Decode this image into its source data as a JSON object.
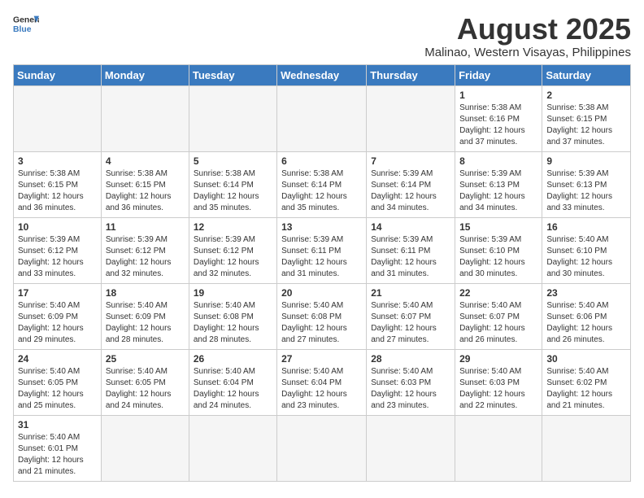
{
  "header": {
    "logo_general": "General",
    "logo_blue": "Blue",
    "month_year": "August 2025",
    "location": "Malinao, Western Visayas, Philippines"
  },
  "days_of_week": [
    "Sunday",
    "Monday",
    "Tuesday",
    "Wednesday",
    "Thursday",
    "Friday",
    "Saturday"
  ],
  "weeks": [
    [
      {
        "day": "",
        "info": ""
      },
      {
        "day": "",
        "info": ""
      },
      {
        "day": "",
        "info": ""
      },
      {
        "day": "",
        "info": ""
      },
      {
        "day": "",
        "info": ""
      },
      {
        "day": "1",
        "info": "Sunrise: 5:38 AM\nSunset: 6:16 PM\nDaylight: 12 hours\nand 37 minutes."
      },
      {
        "day": "2",
        "info": "Sunrise: 5:38 AM\nSunset: 6:15 PM\nDaylight: 12 hours\nand 37 minutes."
      }
    ],
    [
      {
        "day": "3",
        "info": "Sunrise: 5:38 AM\nSunset: 6:15 PM\nDaylight: 12 hours\nand 36 minutes."
      },
      {
        "day": "4",
        "info": "Sunrise: 5:38 AM\nSunset: 6:15 PM\nDaylight: 12 hours\nand 36 minutes."
      },
      {
        "day": "5",
        "info": "Sunrise: 5:38 AM\nSunset: 6:14 PM\nDaylight: 12 hours\nand 35 minutes."
      },
      {
        "day": "6",
        "info": "Sunrise: 5:38 AM\nSunset: 6:14 PM\nDaylight: 12 hours\nand 35 minutes."
      },
      {
        "day": "7",
        "info": "Sunrise: 5:39 AM\nSunset: 6:14 PM\nDaylight: 12 hours\nand 34 minutes."
      },
      {
        "day": "8",
        "info": "Sunrise: 5:39 AM\nSunset: 6:13 PM\nDaylight: 12 hours\nand 34 minutes."
      },
      {
        "day": "9",
        "info": "Sunrise: 5:39 AM\nSunset: 6:13 PM\nDaylight: 12 hours\nand 33 minutes."
      }
    ],
    [
      {
        "day": "10",
        "info": "Sunrise: 5:39 AM\nSunset: 6:12 PM\nDaylight: 12 hours\nand 33 minutes."
      },
      {
        "day": "11",
        "info": "Sunrise: 5:39 AM\nSunset: 6:12 PM\nDaylight: 12 hours\nand 32 minutes."
      },
      {
        "day": "12",
        "info": "Sunrise: 5:39 AM\nSunset: 6:12 PM\nDaylight: 12 hours\nand 32 minutes."
      },
      {
        "day": "13",
        "info": "Sunrise: 5:39 AM\nSunset: 6:11 PM\nDaylight: 12 hours\nand 31 minutes."
      },
      {
        "day": "14",
        "info": "Sunrise: 5:39 AM\nSunset: 6:11 PM\nDaylight: 12 hours\nand 31 minutes."
      },
      {
        "day": "15",
        "info": "Sunrise: 5:39 AM\nSunset: 6:10 PM\nDaylight: 12 hours\nand 30 minutes."
      },
      {
        "day": "16",
        "info": "Sunrise: 5:40 AM\nSunset: 6:10 PM\nDaylight: 12 hours\nand 30 minutes."
      }
    ],
    [
      {
        "day": "17",
        "info": "Sunrise: 5:40 AM\nSunset: 6:09 PM\nDaylight: 12 hours\nand 29 minutes."
      },
      {
        "day": "18",
        "info": "Sunrise: 5:40 AM\nSunset: 6:09 PM\nDaylight: 12 hours\nand 28 minutes."
      },
      {
        "day": "19",
        "info": "Sunrise: 5:40 AM\nSunset: 6:08 PM\nDaylight: 12 hours\nand 28 minutes."
      },
      {
        "day": "20",
        "info": "Sunrise: 5:40 AM\nSunset: 6:08 PM\nDaylight: 12 hours\nand 27 minutes."
      },
      {
        "day": "21",
        "info": "Sunrise: 5:40 AM\nSunset: 6:07 PM\nDaylight: 12 hours\nand 27 minutes."
      },
      {
        "day": "22",
        "info": "Sunrise: 5:40 AM\nSunset: 6:07 PM\nDaylight: 12 hours\nand 26 minutes."
      },
      {
        "day": "23",
        "info": "Sunrise: 5:40 AM\nSunset: 6:06 PM\nDaylight: 12 hours\nand 26 minutes."
      }
    ],
    [
      {
        "day": "24",
        "info": "Sunrise: 5:40 AM\nSunset: 6:05 PM\nDaylight: 12 hours\nand 25 minutes."
      },
      {
        "day": "25",
        "info": "Sunrise: 5:40 AM\nSunset: 6:05 PM\nDaylight: 12 hours\nand 24 minutes."
      },
      {
        "day": "26",
        "info": "Sunrise: 5:40 AM\nSunset: 6:04 PM\nDaylight: 12 hours\nand 24 minutes."
      },
      {
        "day": "27",
        "info": "Sunrise: 5:40 AM\nSunset: 6:04 PM\nDaylight: 12 hours\nand 23 minutes."
      },
      {
        "day": "28",
        "info": "Sunrise: 5:40 AM\nSunset: 6:03 PM\nDaylight: 12 hours\nand 23 minutes."
      },
      {
        "day": "29",
        "info": "Sunrise: 5:40 AM\nSunset: 6:03 PM\nDaylight: 12 hours\nand 22 minutes."
      },
      {
        "day": "30",
        "info": "Sunrise: 5:40 AM\nSunset: 6:02 PM\nDaylight: 12 hours\nand 21 minutes."
      }
    ],
    [
      {
        "day": "31",
        "info": "Sunrise: 5:40 AM\nSunset: 6:01 PM\nDaylight: 12 hours\nand 21 minutes."
      },
      {
        "day": "",
        "info": ""
      },
      {
        "day": "",
        "info": ""
      },
      {
        "day": "",
        "info": ""
      },
      {
        "day": "",
        "info": ""
      },
      {
        "day": "",
        "info": ""
      },
      {
        "day": "",
        "info": ""
      }
    ]
  ]
}
